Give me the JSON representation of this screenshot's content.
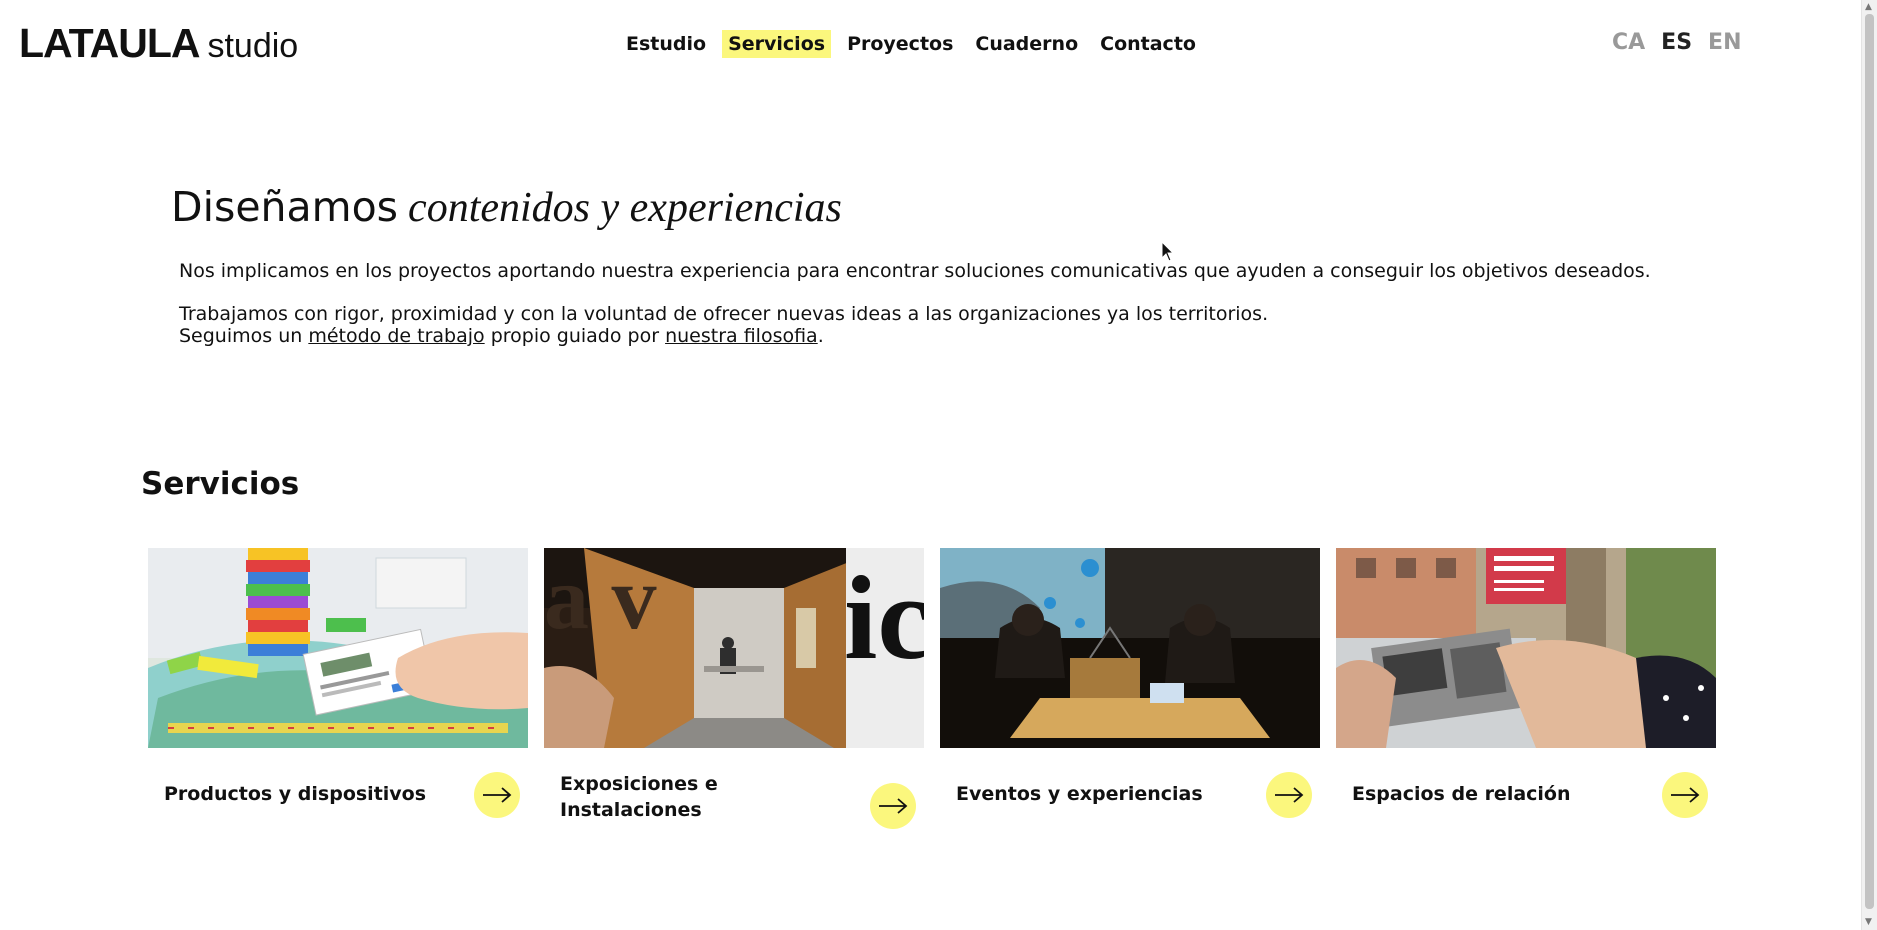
{
  "header": {
    "logo_main": "LATAULA",
    "logo_sub": "studio",
    "nav": [
      "Estudio",
      "Servicios",
      "Proyectos",
      "Cuaderno",
      "Contacto"
    ],
    "nav_active": "Servicios",
    "languages": [
      "CA",
      "ES",
      "EN"
    ],
    "language_active": "ES"
  },
  "intro": {
    "headline_plain": "Diseñamos",
    "headline_italic": "contenidos y experiencias",
    "p1": "Nos implicamos en los proyectos aportando nuestra experiencia para encontrar soluciones comunicativas que ayuden a conseguir los objetivos deseados.",
    "p2": "Trabajamos con rigor, proximidad y con la voluntad de ofrecer nuevas ideas a las organizaciones ya los territorios.",
    "p3_before": "Seguimos un",
    "p3_link1": "método de trabajo",
    "p3_middle": "propio guiado por",
    "p3_link2": "nuestra filosofia",
    "p3_after": "."
  },
  "services": {
    "title": "Servicios",
    "cards": [
      {
        "line1": "Productos y dispositivos",
        "line2": ""
      },
      {
        "line1": "Exposiciones e",
        "line2": "Instalaciones"
      },
      {
        "line1": "Eventos y experiencias",
        "line2": ""
      },
      {
        "line1": "Espacios de relación",
        "line2": ""
      }
    ]
  },
  "colors": {
    "accent_yellow": "#fbf77d",
    "text": "#111111",
    "lang_inactive": "#999999"
  },
  "icons": [
    "arrow-right-icon",
    "mouse-cursor-icon"
  ]
}
